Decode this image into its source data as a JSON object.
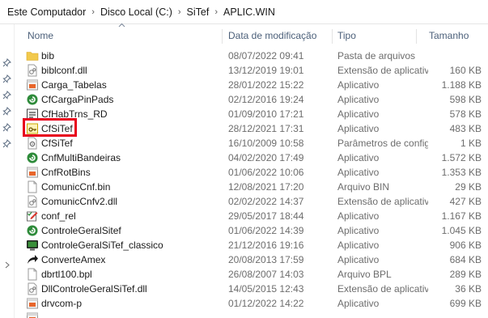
{
  "breadcrumb": [
    "Este Computador",
    "Disco Local (C:)",
    "SiTef",
    "APLIC.WIN"
  ],
  "columns": {
    "name": "Nome",
    "date": "Data de modificação",
    "type": "Tipo",
    "size": "Tamanho"
  },
  "files": [
    {
      "name": "bib",
      "date": "08/07/2022 09:41",
      "type": "Pasta de arquivos",
      "size": "",
      "icon": "folder-icon"
    },
    {
      "name": "biblconf.dll",
      "date": "13/12/2019 19:01",
      "type": "Extensão de aplicativo",
      "size": "160 KB",
      "icon": "dll-icon"
    },
    {
      "name": "Carga_Tabelas",
      "date": "28/01/2022 15:22",
      "type": "Aplicativo",
      "size": "1.188 KB",
      "icon": "app-orange-icon"
    },
    {
      "name": "CfCargaPinPads",
      "date": "02/12/2016 19:24",
      "type": "Aplicativo",
      "size": "598 KB",
      "icon": "sitef-green-icon"
    },
    {
      "name": "CfHabTrns_RD",
      "date": "01/09/2010 17:21",
      "type": "Aplicativo",
      "size": "578 KB",
      "icon": "settings-app-icon"
    },
    {
      "name": "CfSiTef",
      "date": "28/12/2021 17:31",
      "type": "Aplicativo",
      "size": "483 KB",
      "icon": "key-app-icon"
    },
    {
      "name": "CfSiTef",
      "date": "16/10/2009 10:58",
      "type": "Parâmetros de config...",
      "size": "1 KB",
      "icon": "config-file-icon"
    },
    {
      "name": "CnfMultiBandeiras",
      "date": "04/02/2020 17:49",
      "type": "Aplicativo",
      "size": "1.572 KB",
      "icon": "sitef-green-icon"
    },
    {
      "name": "CnfRotBins",
      "date": "01/06/2022 10:06",
      "type": "Aplicativo",
      "size": "1.353 KB",
      "icon": "app-orange-icon"
    },
    {
      "name": "ComunicCnf.bin",
      "date": "12/08/2021 17:20",
      "type": "Arquivo BIN",
      "size": "29 KB",
      "icon": "file-icon"
    },
    {
      "name": "ComunicCnfv2.dll",
      "date": "02/02/2022 14:37",
      "type": "Extensão de aplicativo",
      "size": "427 KB",
      "icon": "dll-icon"
    },
    {
      "name": "conf_rel",
      "date": "29/05/2017 18:44",
      "type": "Aplicativo",
      "size": "1.167 KB",
      "icon": "edit-app-icon"
    },
    {
      "name": "ControleGeralSitef",
      "date": "01/06/2022 14:39",
      "type": "Aplicativo",
      "size": "1.045 KB",
      "icon": "sitef-green-icon"
    },
    {
      "name": "ControleGeralSiTef_classico",
      "date": "21/12/2016 19:16",
      "type": "Aplicativo",
      "size": "906 KB",
      "icon": "monitor-app-icon"
    },
    {
      "name": "ConverteAmex",
      "date": "20/08/2013 17:59",
      "type": "Aplicativo",
      "size": "684 KB",
      "icon": "arrow-app-icon"
    },
    {
      "name": "dbrtl100.bpl",
      "date": "26/08/2007 14:03",
      "type": "Arquivo BPL",
      "size": "289 KB",
      "icon": "file-icon"
    },
    {
      "name": "DllControleGeralSiTef.dll",
      "date": "14/05/2015 12:43",
      "type": "Extensão de aplicativo",
      "size": "36 KB",
      "icon": "dll-icon"
    },
    {
      "name": "drvcom-p",
      "date": "01/12/2022 14:22",
      "type": "Aplicativo",
      "size": "699 KB",
      "icon": "app-orange-icon"
    },
    {
      "name": "",
      "date": "",
      "type": "",
      "size": "",
      "icon": "app-orange-icon"
    }
  ],
  "colors": {
    "highlight": "#e8001c",
    "folder": "#f2c94c",
    "header_text": "#4c607a",
    "meta_text": "#6d6d6d"
  }
}
